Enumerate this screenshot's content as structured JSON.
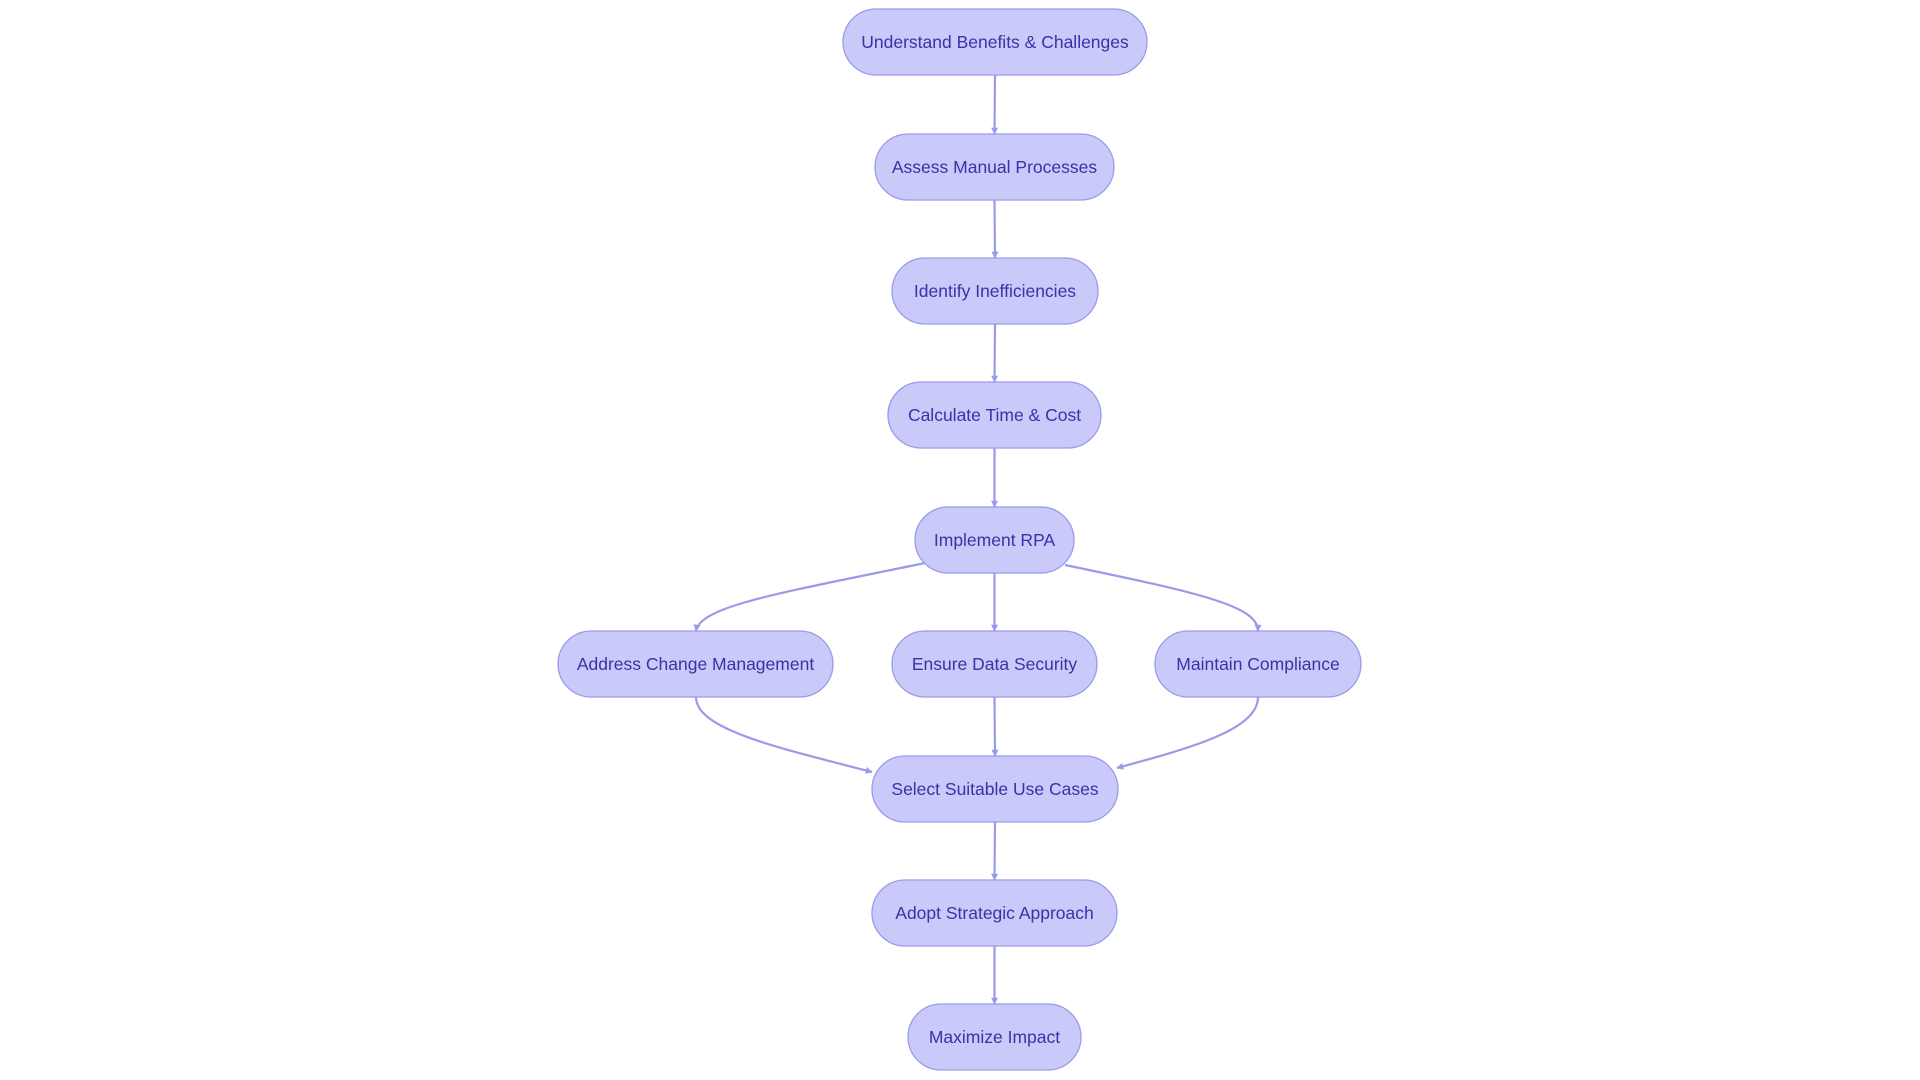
{
  "diagram": {
    "type": "flowchart",
    "direction": "top-to-bottom",
    "colors": {
      "background": "#ffffff",
      "node_fill": "#c9c9fa",
      "node_stroke": "#9a9be8",
      "node_text": "#3535a6",
      "edge": "#9a9be8"
    },
    "nodes": [
      {
        "id": "understand",
        "label": "Understand Benefits & Challenges"
      },
      {
        "id": "assess",
        "label": "Assess Manual Processes"
      },
      {
        "id": "identify",
        "label": "Identify Inefficiencies"
      },
      {
        "id": "calculate",
        "label": "Calculate Time & Cost"
      },
      {
        "id": "implement",
        "label": "Implement RPA"
      },
      {
        "id": "change",
        "label": "Address Change Management"
      },
      {
        "id": "security",
        "label": "Ensure Data Security"
      },
      {
        "id": "compliance",
        "label": "Maintain Compliance"
      },
      {
        "id": "select",
        "label": "Select Suitable Use Cases"
      },
      {
        "id": "adopt",
        "label": "Adopt Strategic Approach"
      },
      {
        "id": "maximize",
        "label": "Maximize Impact"
      }
    ],
    "edges": [
      {
        "from": "understand",
        "to": "assess"
      },
      {
        "from": "assess",
        "to": "identify"
      },
      {
        "from": "identify",
        "to": "calculate"
      },
      {
        "from": "calculate",
        "to": "implement"
      },
      {
        "from": "implement",
        "to": "change"
      },
      {
        "from": "implement",
        "to": "security"
      },
      {
        "from": "implement",
        "to": "compliance"
      },
      {
        "from": "change",
        "to": "select"
      },
      {
        "from": "security",
        "to": "select"
      },
      {
        "from": "compliance",
        "to": "select"
      },
      {
        "from": "select",
        "to": "adopt"
      },
      {
        "from": "adopt",
        "to": "maximize"
      }
    ]
  }
}
